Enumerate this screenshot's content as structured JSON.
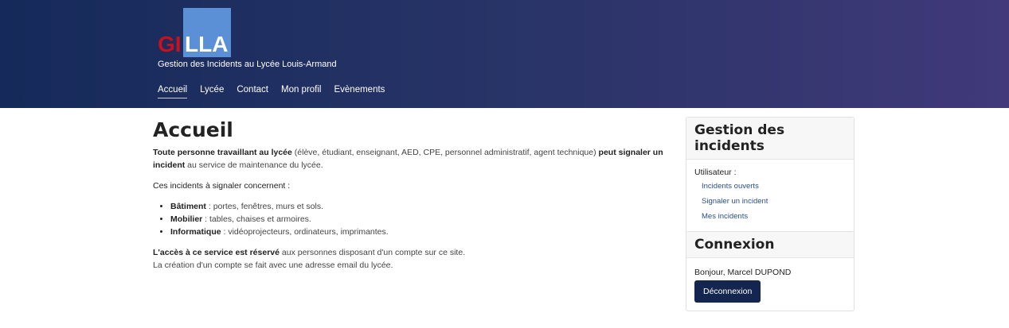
{
  "header": {
    "logo_left": "GI",
    "logo_right": "LLA",
    "subtitle": "Gestion des Incidents au Lycée Louis-Armand",
    "nav": [
      {
        "label": "Accueil"
      },
      {
        "label": "Lycée"
      },
      {
        "label": "Contact"
      },
      {
        "label": "Mon profil"
      },
      {
        "label": "Evènements"
      }
    ]
  },
  "main": {
    "title": "Accueil",
    "intro_bold1": "Toute personne travaillant au lycée",
    "intro_text1": " (élève, étudiant, enseignant, AED, CPE, personnel administratif, agent technique) ",
    "intro_bold2": "peut signaler un incident",
    "intro_text2": " au service de maintenance du lycée.",
    "concern": "Ces incidents à signaler concernent :",
    "items": [
      {
        "bold": "Bâtiment",
        "text": " : portes, fenêtres, murs et sols."
      },
      {
        "bold": "Mobilier",
        "text": " : tables, chaises et armoires."
      },
      {
        "bold": "Informatique",
        "text": " : vidéoprojecteurs, ordinateurs, imprimantes."
      }
    ],
    "access_bold": "L'accès à ce service est réservé",
    "access_text": " aux personnes disposant d'un compte sur ce site.",
    "creation": "La création d'un compte se fait avec une adresse email du lycée."
  },
  "sidebar": {
    "incidents": {
      "title": "Gestion des incidents",
      "user_label": "Utilisateur :",
      "links": [
        "Incidents ouverts",
        "Signaler un incident",
        "Mes incidents"
      ]
    },
    "connexion": {
      "title": "Connexion",
      "greeting": "Bonjour, Marcel DUPOND",
      "logout_label": "Déconnexion"
    }
  },
  "colors": {
    "header_start": "#152a5a",
    "header_end": "#41397a",
    "logo_red": "#c8101e",
    "logo_blue": "#5b8fd6",
    "button": "#142650",
    "link": "#2c4f8a"
  }
}
